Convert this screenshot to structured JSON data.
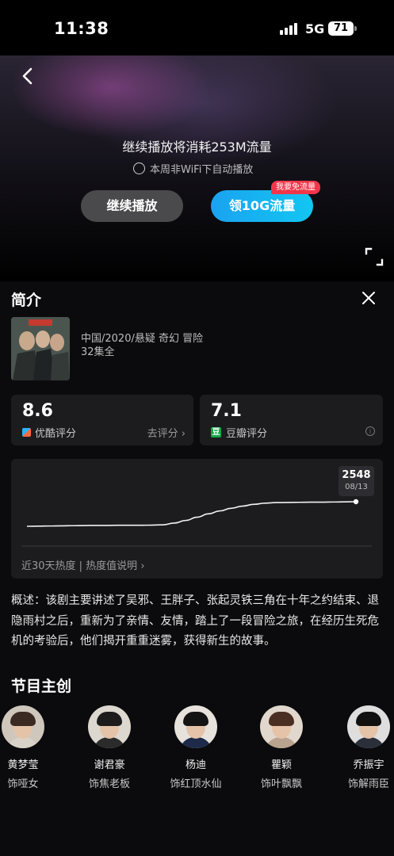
{
  "status_bar": {
    "time": "11:38",
    "network": "5G",
    "battery": "71"
  },
  "player": {
    "notice": "继续播放将消耗253M流量",
    "autoplay_label": "本周非WiFi下自动播放",
    "continue_button": "继续播放",
    "data_button": "领10G流量",
    "free_badge": "我要免流量"
  },
  "intro": {
    "title": "简介",
    "meta_line": "中国/2020/悬疑 奇幻 冒险",
    "episodes": "32集全",
    "youku": {
      "score": "8.6",
      "label": "优酷评分",
      "rate_link": "去评分 ›"
    },
    "douban": {
      "score": "7.1",
      "label": "豆瓣评分",
      "icon_text": "豆"
    },
    "heat": {
      "tooltip_value": "2548",
      "tooltip_date": "08/13",
      "footer": "近30天热度 | 热度值说明 ›"
    },
    "summary": "概述：该剧主要讲述了吴邪、王胖子、张起灵铁三角在十年之约结束、退隐雨村之后，重新为了亲情、友情，踏上了一段冒险之旅，在经历生死危机的考验后，他们揭开重重迷雾，获得新生的故事。"
  },
  "cast_section": {
    "title": "节目主创",
    "members": [
      {
        "name": "黄梦莹",
        "role": "饰哑女",
        "hair": "#3a2a22",
        "shirt": "#d9d2c8",
        "bg": "#cfc6bc"
      },
      {
        "name": "谢君豪",
        "role": "饰焦老板",
        "hair": "#1c1c1c",
        "shirt": "#2b2b2b",
        "bg": "#dcd8cf"
      },
      {
        "name": "杨迪",
        "role": "饰红顶水仙",
        "hair": "#141414",
        "shirt": "#1d2a4a",
        "bg": "#e7e3dc"
      },
      {
        "name": "瞿颖",
        "role": "饰叶飘飘",
        "hair": "#4a2e22",
        "shirt": "#b9a28e",
        "bg": "#e1d7cc"
      },
      {
        "name": "乔振宇",
        "role": "饰解雨臣",
        "hair": "#111111",
        "shirt": "#2a2f3a",
        "bg": "#dedede"
      }
    ]
  },
  "chart_data": {
    "type": "line",
    "values": [
      2380,
      2381,
      2382,
      2383,
      2384,
      2385,
      2386,
      2386,
      2387,
      2387,
      2387,
      2388,
      2390,
      2402,
      2420,
      2442,
      2465,
      2485,
      2503,
      2518,
      2530,
      2538,
      2542,
      2543,
      2544,
      2545,
      2545,
      2546,
      2547,
      2548
    ],
    "xlabel": "近30天热度",
    "annotation": {
      "value": "2548",
      "date": "08/13"
    }
  }
}
